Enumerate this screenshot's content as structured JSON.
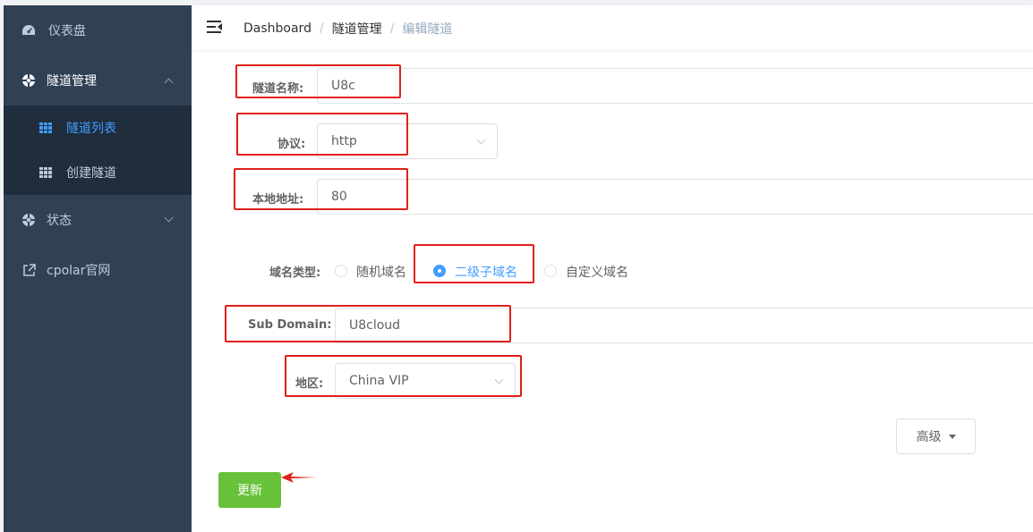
{
  "sidebar": {
    "dashboard": "仪表盘",
    "tunnel_mgmt": "隧道管理",
    "tunnel_list": "隧道列表",
    "create_tunnel": "创建隧道",
    "status": "状态",
    "cpolar_site": "cpolar官网"
  },
  "breadcrumb": {
    "home": "Dashboard",
    "section": "隧道管理",
    "current": "编辑隧道",
    "separator": "/"
  },
  "form": {
    "name_label": "隧道名称:",
    "name_value": "U8c",
    "protocol_label": "协议:",
    "protocol_value": "http",
    "local_addr_label": "本地地址:",
    "local_addr_value": "80",
    "domain_type_label": "域名类型:",
    "domain_type_options": [
      "随机域名",
      "二级子域名",
      "自定义域名"
    ],
    "domain_type_selected": "二级子域名",
    "subdomain_label": "Sub Domain:",
    "subdomain_value": "U8cloud",
    "region_label": "地区:",
    "region_value": "China VIP"
  },
  "buttons": {
    "advanced": "高级",
    "update": "更新"
  },
  "colors": {
    "sidebar_bg": "#304156",
    "submenu_bg": "#1f2d3d",
    "active_blue": "#409eff",
    "update_green": "#67c23a",
    "annotation_red": "#e0201a"
  }
}
